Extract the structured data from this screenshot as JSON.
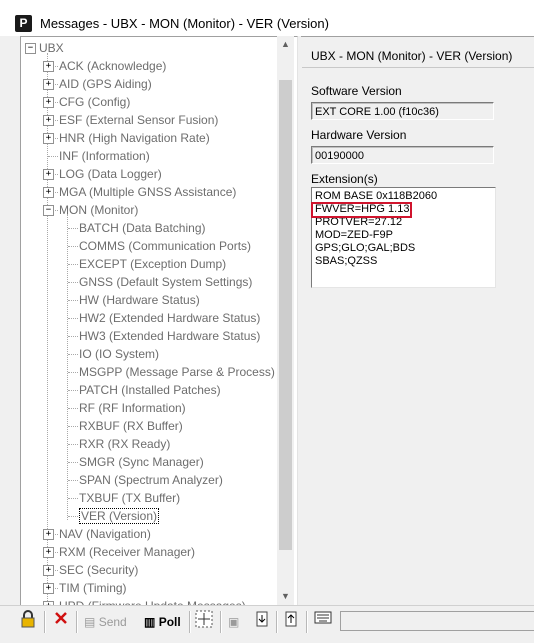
{
  "window": {
    "app_icon": "P",
    "title": "Messages - UBX - MON (Monitor) - VER (Version)"
  },
  "tree": {
    "root": "UBX",
    "top": [
      "ACK (Acknowledge)",
      "AID (GPS Aiding)",
      "CFG (Config)",
      "ESF (External Sensor Fusion)",
      "HNR (High Navigation Rate)",
      "INF (Information)",
      "LOG (Data Logger)",
      "MGA (Multiple GNSS Assistance)",
      "MON (Monitor)"
    ],
    "mon_children": [
      "BATCH (Data Batching)",
      "COMMS (Communication Ports)",
      "EXCEPT (Exception Dump)",
      "GNSS (Default System Settings)",
      "HW (Hardware Status)",
      "HW2 (Extended Hardware Status)",
      "HW3 (Extended Hardware Status)",
      "IO (IO System)",
      "MSGPP (Message Parse & Process)",
      "PATCH (Installed Patches)",
      "RF (RF Information)",
      "RXBUF (RX Buffer)",
      "RXR (RX Ready)",
      "SMGR (Sync Manager)",
      "SPAN (Spectrum Analyzer)",
      "TXBUF (TX Buffer)",
      "VER (Version)"
    ],
    "bottom": [
      "NAV (Navigation)",
      "RXM (Receiver Manager)",
      "SEC (Security)",
      "TIM (Timing)",
      "UPD (Firmware Update Messages)"
    ]
  },
  "panel": {
    "title": "UBX - MON (Monitor) - VER (Version)",
    "software_label": "Software Version",
    "software_value": "EXT CORE 1.00 (f10c36)",
    "hardware_label": "Hardware Version",
    "hardware_value": "00190000",
    "extensions_label": "Extension(s)",
    "extensions": [
      "ROM BASE 0x118B2060",
      "FWVER=HPG 1.13",
      "PROTVER=27.12",
      "MOD=ZED-F9P",
      "GPS;GLO;GAL;BDS",
      "SBAS;QZSS"
    ],
    "highlight_color": "#d0142d"
  },
  "toolbar": {
    "send_label": "Send",
    "poll_label": "Poll"
  },
  "icons": [
    "lock-icon",
    "delete-icon",
    "send-icon",
    "poll-icon",
    "crosshair-icon",
    "copy-icon",
    "import-icon",
    "export-icon",
    "keyboard-icon"
  ]
}
